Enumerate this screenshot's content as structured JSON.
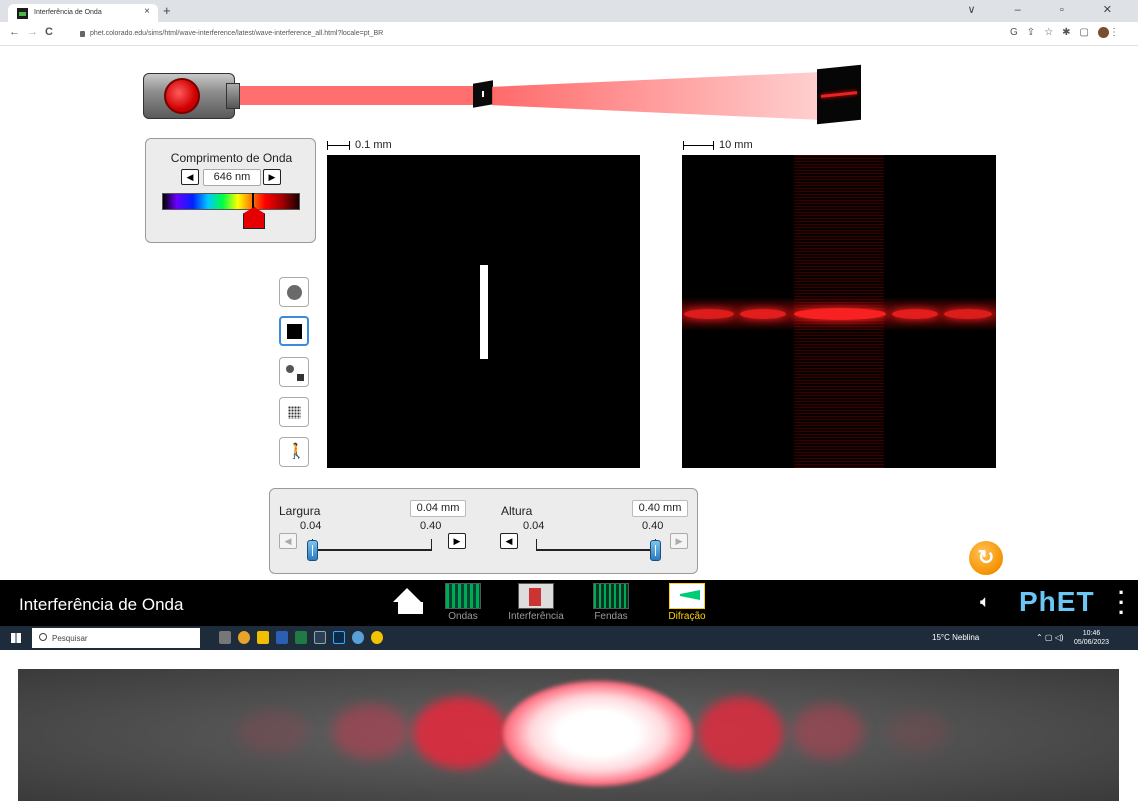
{
  "browser": {
    "tab_title": "Interferência de Onda",
    "tab_close": "×",
    "new_tab": "+",
    "url": "phet.colorado.edu/sims/html/wave-interference/latest/wave-interference_all.html?locale=pt_BR",
    "window_controls": "∨ – ▫ ✕",
    "back": "←",
    "forward": "→",
    "reload": "C"
  },
  "wavelength": {
    "title": "Comprimento de Onda",
    "value": "646 nm",
    "left_arrow": "◀",
    "right_arrow": "▶"
  },
  "scales": {
    "aperture": "0.1 mm",
    "pattern": "10 mm"
  },
  "controls": {
    "width": {
      "label": "Largura",
      "value": "0.04 mm",
      "min": "0.04",
      "max": "0.40",
      "level": 0.0,
      "left_arrow": "◀",
      "right_arrow": "▶"
    },
    "height": {
      "label": "Altura",
      "value": "0.40 mm",
      "min": "0.04",
      "max": "0.40",
      "level": 1.0,
      "left_arrow": "◀",
      "right_arrow": "▶"
    }
  },
  "navbar": {
    "title": "Interferência de Onda",
    "tabs": [
      {
        "label": "Ondas",
        "icon": "waves-screen-icon"
      },
      {
        "label": "Interferência",
        "icon": "interference-screen-icon"
      },
      {
        "label": "Fendas",
        "icon": "slits-screen-icon"
      },
      {
        "label": "Difração",
        "icon": "diffraction-screen-icon"
      }
    ],
    "active_tab": "Difração",
    "active_color": "#ffd200",
    "logo": "PhET"
  },
  "taskbar": {
    "search_placeholder": "Pesquisar",
    "weather": "15°C Neblina",
    "time": "10:46",
    "date": "05/06/2023"
  },
  "colors": {
    "laser": "#e40000",
    "slider": "#2a7cc0",
    "reset": "#f59200"
  }
}
